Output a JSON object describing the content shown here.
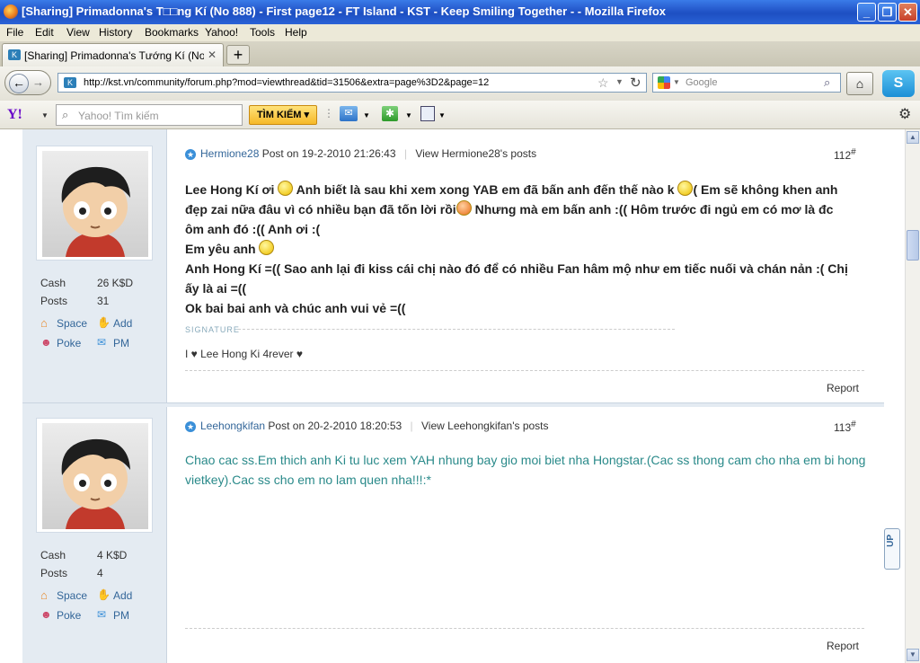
{
  "window": {
    "title": "[Sharing] Primadonna's T□□ng Kí (No 888) - First page12 - FT Island - KST - Keep Smiling Together - - Mozilla Firefox",
    "minimize_icon": "minimize-icon",
    "maximize_icon": "maximize-icon",
    "close_icon": "close-icon"
  },
  "menubar": {
    "items": [
      "File",
      "Edit",
      "View",
      "History",
      "Bookmarks",
      "Yahoo!",
      "Tools",
      "Help"
    ]
  },
  "tabs": [
    {
      "label": "[Sharing] Primadonna's Tướng Kí (No 888) - ..."
    }
  ],
  "navbar": {
    "url": "http://kst.vn/community/forum.php?mod=viewthread&tid=31506&extra=page%3D2&page=12",
    "search_placeholder": "Google"
  },
  "yahoo_toolbar": {
    "logo": "Y!",
    "search_placeholder": "Yahoo! Tìm kiếm",
    "search_button": "TÌM KIẾM"
  },
  "posts": [
    {
      "author": "Hermione28",
      "posted": "Post on 19-2-2010 21:26:43",
      "view_posts": "View Hermione28's posts",
      "number": "112",
      "number_sup": "#",
      "stats": {
        "cash_label": "Cash",
        "cash_value": "26 K$D",
        "posts_label": "Posts",
        "posts_value": "31"
      },
      "links": {
        "space": "Space",
        "add": "Add",
        "poke": "Poke",
        "pm": "PM"
      },
      "body": {
        "line1a": "Lee Hong Kí ơi",
        "line1b": "Anh biết là sau khi xem xong YAB em đã bấn anh đến thế nào k",
        "line1c": "( Em sẽ không khen anh",
        "line2a": "đẹp zai nữa đâu vì có nhiều bạn đã tốn lời rồi",
        "line2b": "Nhưng mà em bấn anh :(( Hôm trước đi ngủ em có mơ là đc",
        "line3": "ôm anh đó :(( Anh ơi :(",
        "line4": "Em yêu anh",
        "line5": "Anh Hong Kí =(( Sao anh lại đi kiss cái chị nào đó để có nhiều Fan hâm mộ như em tiếc nuối và chán nản :( Chị",
        "line6": "ấy là ai =((",
        "line7": "Ok bai bai anh và chúc anh vui vẻ =(("
      },
      "signature_label": "SIGNATURE",
      "signature": "I ♥ Lee Hong Ki 4rever ♥",
      "report": "Report"
    },
    {
      "author": "Leehongkifan",
      "posted": "Post on 20-2-2010 18:20:53",
      "view_posts": "View Leehongkifan's posts",
      "number": "113",
      "number_sup": "#",
      "stats": {
        "cash_label": "Cash",
        "cash_value": "4 K$D",
        "posts_label": "Posts",
        "posts_value": "4"
      },
      "links": {
        "space": "Space",
        "add": "Add",
        "poke": "Poke",
        "pm": "PM"
      },
      "body": {
        "line1": "Chao cac ss.Em thich anh Ki tu luc xem YAH nhung bay gio moi biet nha Hongstar.(Cac ss thong cam cho nha em bi hong",
        "line2": "vietkey).Cac ss cho em no lam quen nha!!!:*"
      },
      "report": "Report"
    }
  ],
  "up_button": "UP",
  "colors": {
    "titlebar": "#2356c9",
    "sidebar": "#e4ebf2",
    "link": "#336699",
    "teal_text": "#2a8a8a"
  }
}
